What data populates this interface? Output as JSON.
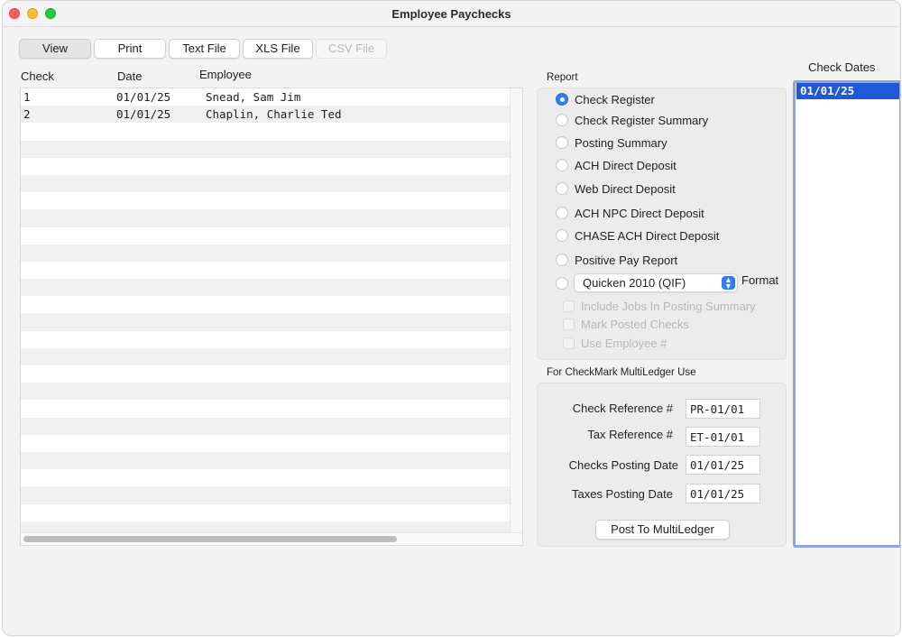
{
  "window": {
    "title": "Employee Paychecks"
  },
  "toolbar": {
    "buttons": [
      {
        "label": "View",
        "state": "active"
      },
      {
        "label": "Print",
        "state": "normal"
      },
      {
        "label": "Text File",
        "state": "normal"
      },
      {
        "label": "XLS File",
        "state": "normal"
      },
      {
        "label": "CSV File",
        "state": "disabled"
      }
    ]
  },
  "table": {
    "columns": [
      "Check",
      "Date",
      "Employee"
    ],
    "rows": [
      {
        "check": "1",
        "date": "01/01/25",
        "employee": "Snead, Sam Jim"
      },
      {
        "check": "2",
        "date": "01/01/25",
        "employee": "Chaplin, Charlie Ted"
      }
    ]
  },
  "report": {
    "label": "Report",
    "options": [
      {
        "label": "Check Register",
        "selected": true
      },
      {
        "label": "Check Register Summary",
        "selected": false
      },
      {
        "label": "Posting Summary",
        "selected": false
      },
      {
        "label": "ACH Direct Deposit",
        "selected": false
      },
      {
        "label": "Web Direct Deposit",
        "selected": false
      },
      {
        "label": "ACH NPC Direct Deposit",
        "selected": false
      },
      {
        "label": "CHASE ACH Direct Deposit",
        "selected": false
      },
      {
        "label": "Positive Pay Report",
        "selected": false
      }
    ],
    "format_option": {
      "selected": false,
      "select_value": "Quicken 2010 (QIF)",
      "label": "Format"
    },
    "checkboxes": [
      {
        "label": "Include Jobs In Posting Summary",
        "checked": false,
        "disabled": true
      },
      {
        "label": "Mark Posted Checks",
        "checked": false,
        "disabled": true
      },
      {
        "label": "Use Employee #",
        "checked": false,
        "disabled": true
      }
    ]
  },
  "multiledger": {
    "label": "For CheckMark MultiLedger Use",
    "fields": [
      {
        "label": "Check Reference #",
        "value": "PR-01/01"
      },
      {
        "label": "Tax Reference #",
        "value": "ET-01/01"
      },
      {
        "label": "Checks Posting Date",
        "value": "01/01/25"
      },
      {
        "label": "Taxes Posting Date",
        "value": "01/01/25"
      }
    ],
    "post_button": "Post To MultiLedger"
  },
  "check_dates": {
    "label": "Check Dates",
    "items": [
      {
        "value": "01/01/25",
        "selected": true
      }
    ]
  },
  "colors": {
    "accent": "#2f7cf6",
    "list_selection": "#2158d6",
    "focus_ring": "#8ea2e6"
  }
}
